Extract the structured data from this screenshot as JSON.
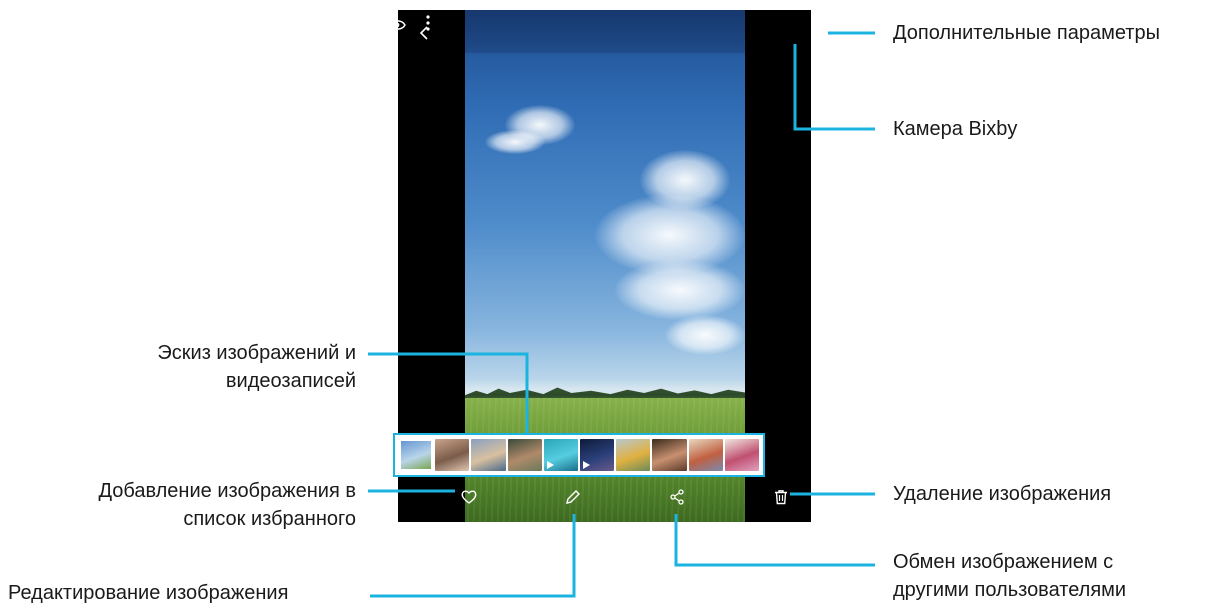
{
  "viewer": {
    "icons": {
      "back": "chevron-left-icon",
      "bixby": "eye-icon",
      "more": "more-vertical-icon",
      "favorite": "heart-icon",
      "edit": "pencil-icon",
      "share": "share-icon",
      "delete": "trash-icon"
    },
    "thumbnails": [
      {
        "kind": "image",
        "colors": [
          "#5a8ecf",
          "#b9d5ea",
          "#6f9e38"
        ],
        "selected": true
      },
      {
        "kind": "image",
        "colors": [
          "#c9a48a",
          "#7b5c4a",
          "#e0c7b2"
        ]
      },
      {
        "kind": "image",
        "colors": [
          "#8aa0c0",
          "#d8c0a0",
          "#4a6a8a"
        ]
      },
      {
        "kind": "image",
        "colors": [
          "#3a4a3a",
          "#b08a6a",
          "#6a7a5a"
        ]
      },
      {
        "kind": "video",
        "colors": [
          "#2aa5b8",
          "#56cde0",
          "#1a6e8a"
        ]
      },
      {
        "kind": "video",
        "colors": [
          "#0d1b3a",
          "#2a3f7a",
          "#6a5a8a"
        ]
      },
      {
        "kind": "image",
        "colors": [
          "#b8c8d0",
          "#e0b040",
          "#6a8a5a"
        ]
      },
      {
        "kind": "image",
        "colors": [
          "#3a2a1a",
          "#c89070",
          "#5a3a2a"
        ]
      },
      {
        "kind": "image",
        "colors": [
          "#e8d8c0",
          "#c06040",
          "#7a8ab0"
        ]
      },
      {
        "kind": "image",
        "colors": [
          "#f0e8e0",
          "#c05070",
          "#e0a0c0"
        ]
      }
    ]
  },
  "labels": {
    "more_options": "Дополнительные параметры",
    "bixby_camera": "Камера Bixby",
    "thumbs_line1": "Эскиз изображений и",
    "thumbs_line2": "видеозаписей",
    "favorite_line1": "Добавление изображения в",
    "favorite_line2": "список избранного",
    "edit": "Редактирование изображения",
    "delete": "Удаление изображения",
    "share_line1": "Обмен изображением с",
    "share_line2": "другими пользователями"
  },
  "colors": {
    "accent": "#1bb4e0",
    "device_background": "#000000",
    "icon": "#ffffff",
    "label_text": "#1a1a1a"
  }
}
